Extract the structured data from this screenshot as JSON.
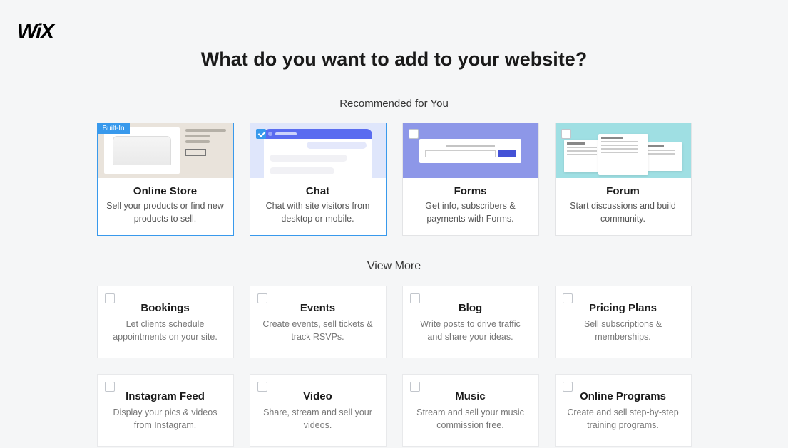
{
  "logo": "WiX",
  "title": "What do you want to add to your website?",
  "subtitle": "Recommended for You",
  "viewmore": "View More",
  "builtin_badge": "Built-In",
  "recommended": [
    {
      "title": "Online Store",
      "desc": "Sell your products or find new products to sell.",
      "builtin": true,
      "checked": false
    },
    {
      "title": "Chat",
      "desc": "Chat with site visitors from desktop or mobile.",
      "builtin": false,
      "checked": true
    },
    {
      "title": "Forms",
      "desc": "Get info, subscribers & payments with Forms.",
      "builtin": false,
      "checked": false
    },
    {
      "title": "Forum",
      "desc": "Start discussions and build community.",
      "builtin": false,
      "checked": false
    }
  ],
  "more": [
    {
      "title": "Bookings",
      "desc": "Let clients schedule appointments on your site."
    },
    {
      "title": "Events",
      "desc": "Create events, sell tickets & track RSVPs."
    },
    {
      "title": "Blog",
      "desc": "Write posts to drive traffic and share your ideas."
    },
    {
      "title": "Pricing Plans",
      "desc": "Sell subscriptions & memberships."
    },
    {
      "title": "Instagram Feed",
      "desc": "Display your pics & videos from Instagram."
    },
    {
      "title": "Video",
      "desc": "Share, stream and sell your videos."
    },
    {
      "title": "Music",
      "desc": "Stream and sell your music commission free."
    },
    {
      "title": "Online Programs",
      "desc": "Create and sell step-by-step training programs."
    }
  ]
}
